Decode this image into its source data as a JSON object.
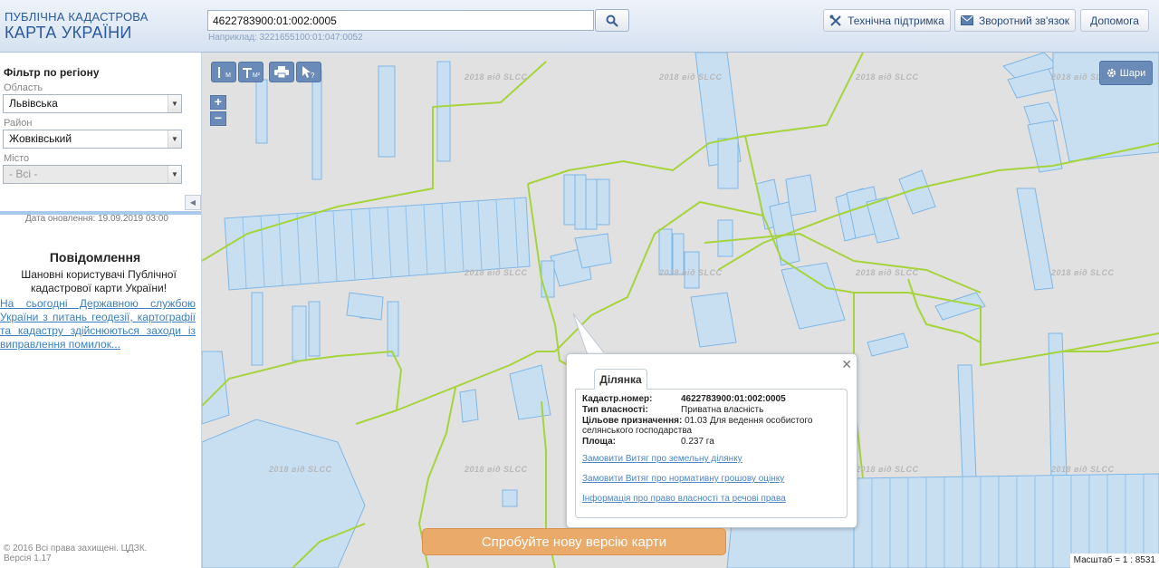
{
  "header": {
    "logo_line1": "ПУБЛІЧНА КАДАСТРОВА",
    "logo_line2": "КАРТА УКРАЇНИ",
    "search_value": "4622783900:01:002:0005",
    "search_example": "Наприклад: 3221655100:01:047:0052",
    "buttons": {
      "support": "Технічна підтримка",
      "feedback": "Зворотний зв'язок",
      "help": "Допомога"
    }
  },
  "sidebar": {
    "filter_title": "Фільтр по регіону",
    "oblast_label": "Область",
    "oblast_value": "Львівська",
    "raion_label": "Район",
    "raion_value": "Жовківський",
    "city_label": "Місто",
    "city_value": "- Всі -",
    "update_date": "Дата оновлення: 19.09.2019 03:00",
    "notice_title": "Повідомлення",
    "notice_body": "Шановні користувачі Публічної кадастрової карти України!",
    "notice_link": "На сьогодні Державною службою України з питань геодезії, картографії та кадастру здійснюються заходи із виправлення помилок...",
    "copyright": "© 2016 Всі права захищені. ЦДЗК. Версія 1.17"
  },
  "map": {
    "tools": {
      "measure_m": "M",
      "measure_m2": "M²"
    },
    "layers_label": "Шари",
    "watermark": "2018 від SLCC",
    "scale": "Масштаб = 1 : 8531",
    "new_version": "Спробуйте нову версію карти"
  },
  "popup": {
    "tab": "Ділянка",
    "fields": [
      {
        "key": "Кадастр.номер:",
        "value": "4622783900:01:002:0005"
      },
      {
        "key": "Тип власності:",
        "value": "Приватна власність"
      },
      {
        "key": "Цільове призначення:",
        "value": "01.03 Для ведення особистого селянського господарства"
      },
      {
        "key": "Площа:",
        "value": "0.237 га"
      }
    ],
    "links": [
      "Замовити Витяг про земельну ділянку",
      "Замовити Витяг про нормативну грошову оцінку",
      "Інформація про право власності та речові права"
    ]
  },
  "colors": {
    "parcel_fill": "#c8dff2",
    "parcel_stroke": "#7fb7e6",
    "boundary": "#a6d43c",
    "header_text": "#2a5a9e",
    "new_version_bg": "#e9aa6a"
  }
}
